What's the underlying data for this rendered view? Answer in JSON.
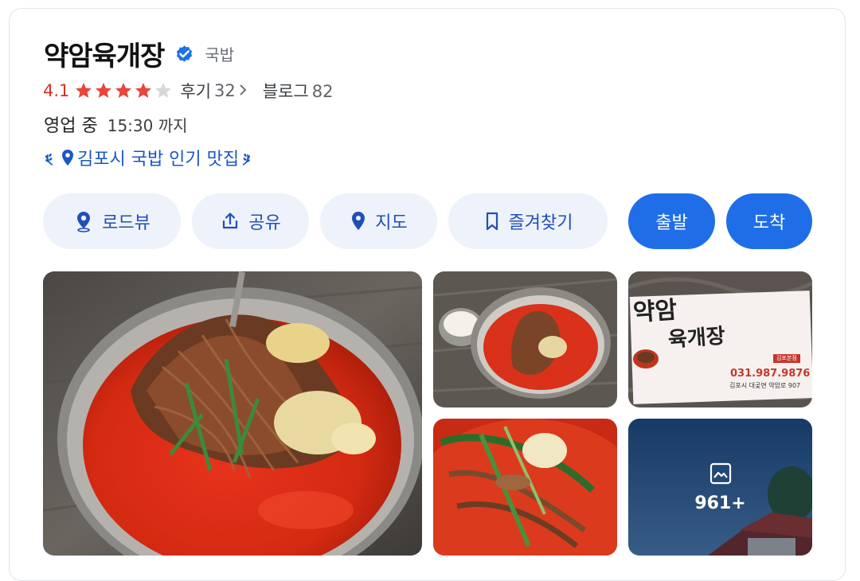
{
  "place": {
    "name": "약암육개장",
    "category": "국밥",
    "verified_icon": "verified-badge-icon"
  },
  "rating": {
    "score": "4.1",
    "stars_value": 4.1,
    "stars_max": 5,
    "review_label": "후기",
    "review_count": "32",
    "blog_label": "블로그",
    "blog_count": "82"
  },
  "hours": {
    "status": "영업 중",
    "detail": "15:30 까지"
  },
  "badge": {
    "text": "김포시 국밥 인기 맛집"
  },
  "actions": [
    {
      "label": "로드뷰",
      "icon": "roadview-pin-icon"
    },
    {
      "label": "공유",
      "icon": "share-icon"
    },
    {
      "label": "지도",
      "icon": "map-pin-icon"
    },
    {
      "label": "즐겨찾기",
      "icon": "bookmark-icon"
    },
    {
      "label": "출발"
    },
    {
      "label": "도착"
    }
  ],
  "photos": {
    "more_count": "961+",
    "more_icon": "gallery-icon",
    "sign": {
      "line1": "약암",
      "line2": "육개장",
      "branch": "김포본점",
      "phone": "031.987.9876",
      "address": "김포시 대곶면 약암로 907"
    }
  },
  "colors": {
    "primary": "#1f6ee8",
    "rating_red": "#d93025",
    "star_red": "#e8453c",
    "badge_blue": "#1a56c4"
  }
}
